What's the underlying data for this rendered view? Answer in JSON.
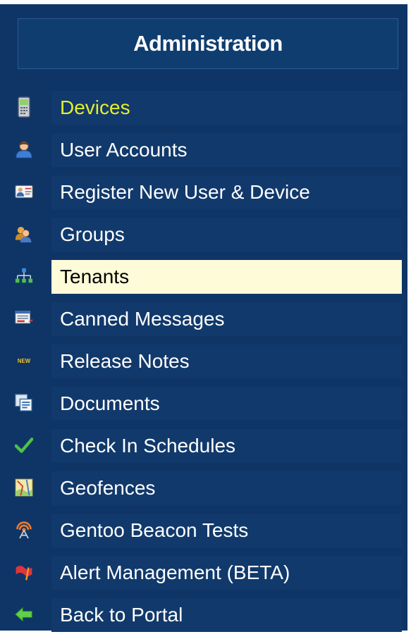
{
  "header": {
    "title": "Administration"
  },
  "menu": {
    "items": [
      {
        "label": "Devices",
        "icon": "mobile-phone-icon",
        "state": "active"
      },
      {
        "label": "User Accounts",
        "icon": "user-icon",
        "state": "normal"
      },
      {
        "label": "Register New User & Device",
        "icon": "id-card-icon",
        "state": "normal"
      },
      {
        "label": "Groups",
        "icon": "group-icon",
        "state": "normal"
      },
      {
        "label": "Tenants",
        "icon": "org-chart-icon",
        "state": "selected"
      },
      {
        "label": "Canned Messages",
        "icon": "message-form-icon",
        "state": "normal"
      },
      {
        "label": "Release Notes",
        "icon": "new-badge-icon",
        "state": "normal"
      },
      {
        "label": "Documents",
        "icon": "documents-icon",
        "state": "normal"
      },
      {
        "label": "Check In Schedules",
        "icon": "checkmark-icon",
        "state": "normal"
      },
      {
        "label": "Geofences",
        "icon": "map-icon",
        "state": "normal"
      },
      {
        "label": "Gentoo Beacon Tests",
        "icon": "beacon-icon",
        "state": "normal"
      },
      {
        "label": "Alert Management (BETA)",
        "icon": "alert-flag-icon",
        "state": "normal"
      },
      {
        "label": "Back to Portal",
        "icon": "back-arrow-icon",
        "state": "normal"
      }
    ]
  },
  "colors": {
    "background": "#0f3567",
    "item_background": "#11396b",
    "active_text": "#e6ee2a",
    "selected_background": "#fdfbd8"
  }
}
